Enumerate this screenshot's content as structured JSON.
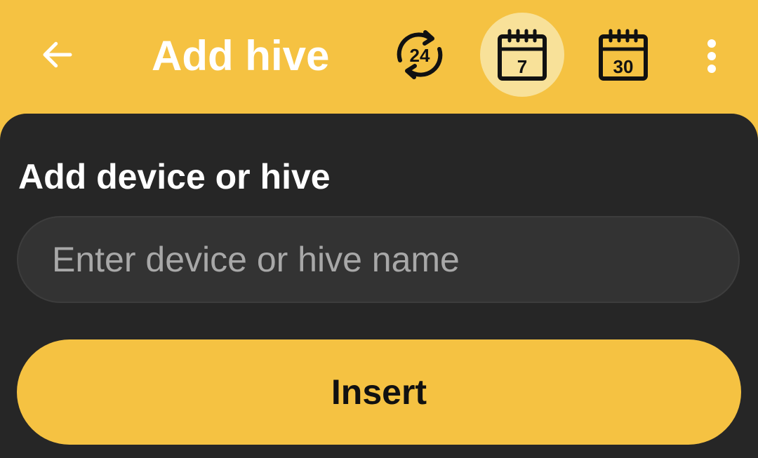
{
  "app_bar": {
    "title": "Add hive",
    "actions": [
      {
        "id": "last-24h",
        "icon": "24-hour-refresh-icon",
        "label": "24",
        "selected": false
      },
      {
        "id": "last-7-days",
        "icon": "calendar-7-icon",
        "label": "7",
        "selected": true
      },
      {
        "id": "last-30-days",
        "icon": "calendar-30-icon",
        "label": "30",
        "selected": false
      }
    ],
    "icons": {
      "back": "arrow-left-icon",
      "overflow": "more-vert-icon"
    }
  },
  "form": {
    "heading": "Add device or hive",
    "name_input": {
      "value": "",
      "placeholder": "Enter device or hive name"
    },
    "insert_label": "Insert"
  },
  "colors": {
    "accent": "#f5c242",
    "accent_selected": "#f8e199",
    "sheet": "#262626",
    "input_bg": "#333333",
    "text_light": "#ffffff",
    "placeholder": "#a8a8a8",
    "text_dark": "#111111"
  }
}
